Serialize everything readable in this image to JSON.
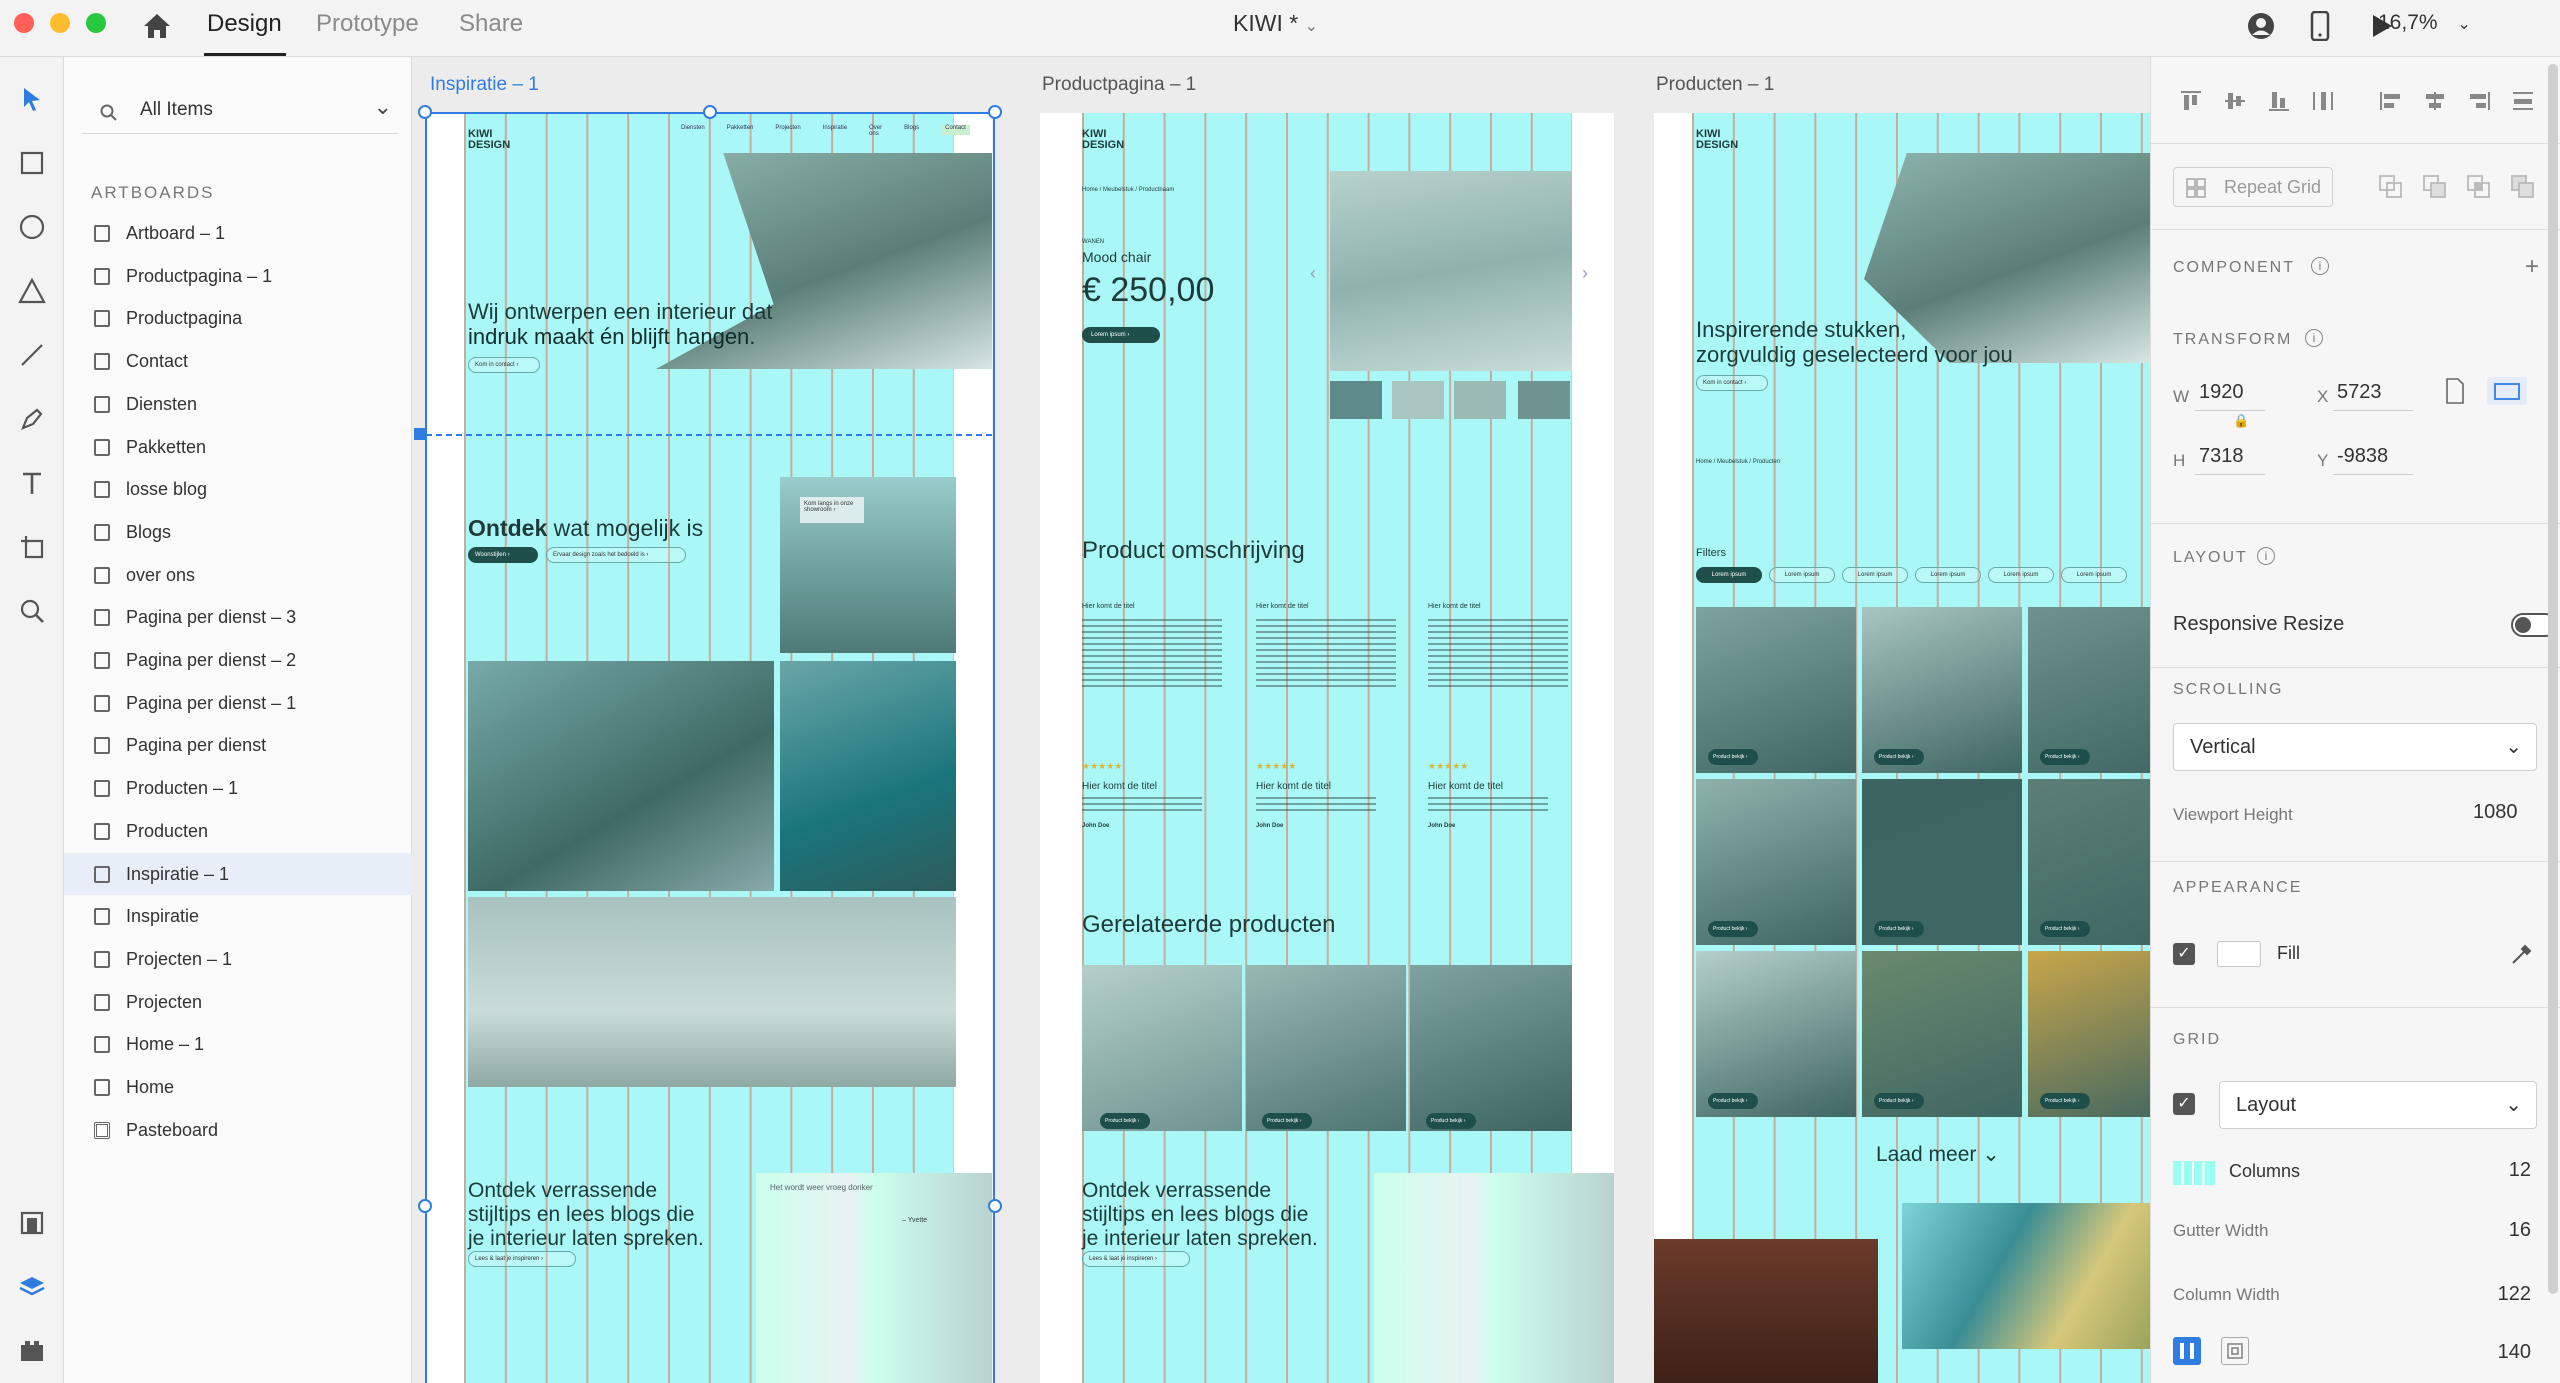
{
  "topbar": {
    "tabs": [
      "Design",
      "Prototype",
      "Share"
    ],
    "doc_title": "KIWI *",
    "zoom": "16,7%"
  },
  "layers": {
    "search_label": "All Items",
    "section_title": "ARTBOARDS",
    "items": [
      "Artboard – 1",
      "Productpagina – 1",
      "Productpagina",
      "Contact",
      "Diensten",
      "Pakketten",
      "losse blog",
      "Blogs",
      "over ons",
      "Pagina per dienst – 3",
      "Pagina per dienst – 2",
      "Pagina per dienst – 1",
      "Pagina per dienst",
      "Producten – 1",
      "Producten",
      "Inspiratie – 1",
      "Inspiratie",
      "Projecten – 1",
      "Projecten",
      "Home – 1",
      "Home",
      "Pasteboard"
    ],
    "selected": "Inspiratie – 1"
  },
  "canvas": {
    "artboards": [
      "Inspiratie – 1",
      "Productpagina – 1",
      "Producten – 1"
    ],
    "inspiratie": {
      "hero_line1": "Wij ontwerpen een interieur dat",
      "hero_line2": "indruk maakt én blijft hangen.",
      "hero_button": "Kom in contact ›",
      "ontdek_bold": "Ontdek",
      "ontdek_rest": " wat mogelijk is",
      "ontdek_btn1": "Woonstijlen ›",
      "ontdek_btn2": "Ervaar design zoals het bedoeld is ›",
      "note": "Kom langs in onze showroom ›",
      "blog_line1": "Ontdek verrassende",
      "blog_line2": "stijltips en lees blogs die",
      "blog_line3": "je interieur laten spreken.",
      "blog_button": "Lees & laat je inspireren ›",
      "magazine_title": "Het wordt weer vroeg donker",
      "magazine_side": "– Yvette"
    },
    "productpagina": {
      "breadcrumb": "Home  /  Meubelstuk  /  Productnaam",
      "category": "WANEN",
      "product_name": "Mood chair",
      "price": "€ 250,00",
      "cta": "Lorem ipsum ›",
      "omschrijving": "Product omschrijving",
      "col_title": "Hier komt de titel",
      "review_title": "Hier komt de titel",
      "review_author": "John Doe",
      "stars": "★★★★★",
      "gerelateerde": "Gerelateerde producten",
      "product_btn": "Product bekijk ›",
      "blog_line1": "Ontdek verrassende",
      "blog_line2": "stijltips en lees blogs die",
      "blog_line3": "je interieur laten spreken.",
      "blog_button": "Lees & laat je inspireren ›"
    },
    "producten": {
      "hero_line1": "Inspirerende stukken,",
      "hero_line2": "zorgvuldig geselecteerd voor jou",
      "hero_button": "Kom in contact ›",
      "breadcrumb": "Home  /  Meubelstuk  /  Producten",
      "filters": "Filters",
      "filter_pill": "Lorem ipsum",
      "product_btn": "Product bekijk ›",
      "laad_meer": "Laad meer ⌄"
    },
    "logo_line1": "KIWI",
    "logo_line2": "DESIGN",
    "nav_items": [
      "Diensten",
      "Pakketten",
      "Projecten",
      "Inspiratie",
      "Over ons",
      "Blogs"
    ],
    "nav_contact": "Contact"
  },
  "props": {
    "repeat_grid": "Repeat Grid",
    "component_label": "COMPONENT",
    "transform_label": "TRANSFORM",
    "w_label": "W",
    "w_value": "1920",
    "x_label": "X",
    "x_value": "5723",
    "h_label": "H",
    "h_value": "7318",
    "y_label": "Y",
    "y_value": "-9838",
    "layout_label": "LAYOUT",
    "responsive_resize": "Responsive Resize",
    "scrolling_label": "SCROLLING",
    "scrolling_value": "Vertical",
    "viewport_height_label": "Viewport Height",
    "viewport_height_value": "1080",
    "appearance_label": "APPEARANCE",
    "fill_label": "Fill",
    "grid_label": "GRID",
    "grid_type": "Layout",
    "columns_label": "Columns",
    "columns_value": "12",
    "gutter_label": "Gutter Width",
    "gutter_value": "16",
    "column_width_label": "Column Width",
    "column_width_value": "122",
    "last_value": "140"
  },
  "colors": {
    "grid_column": "#64f0f0",
    "grid_gutter": "#e16e50",
    "selection": "#2f7de1",
    "dark_button": "#1f4f4b"
  }
}
